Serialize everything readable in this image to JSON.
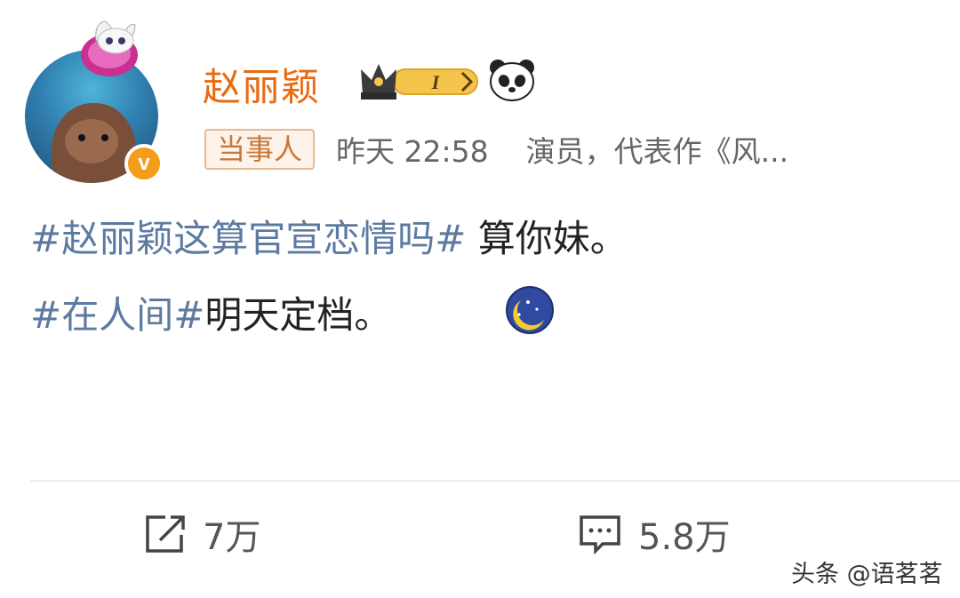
{
  "post": {
    "username": "赵丽颖",
    "tag": "当事人",
    "time": "昨天 22:58",
    "bio": "演员，代表作《风...",
    "line1_topic": "#赵丽颖这算官宣恋情吗#",
    "line1_text": " 算你妹。",
    "line2_topic": "#在人间#",
    "line2_text": "明天定档。",
    "vip_level": "I"
  },
  "actions": {
    "share_count": "7万",
    "comment_count": "5.8万"
  },
  "watermark": "头条 @语茗茗",
  "colors": {
    "username": "#ea6a10",
    "topic": "#5c7aa0",
    "badge": "#f59d1b"
  },
  "icons": [
    "vip-crown-icon",
    "panda-emoji-icon",
    "moon-emoji-icon",
    "share-icon",
    "comment-icon",
    "verified-v-icon"
  ]
}
